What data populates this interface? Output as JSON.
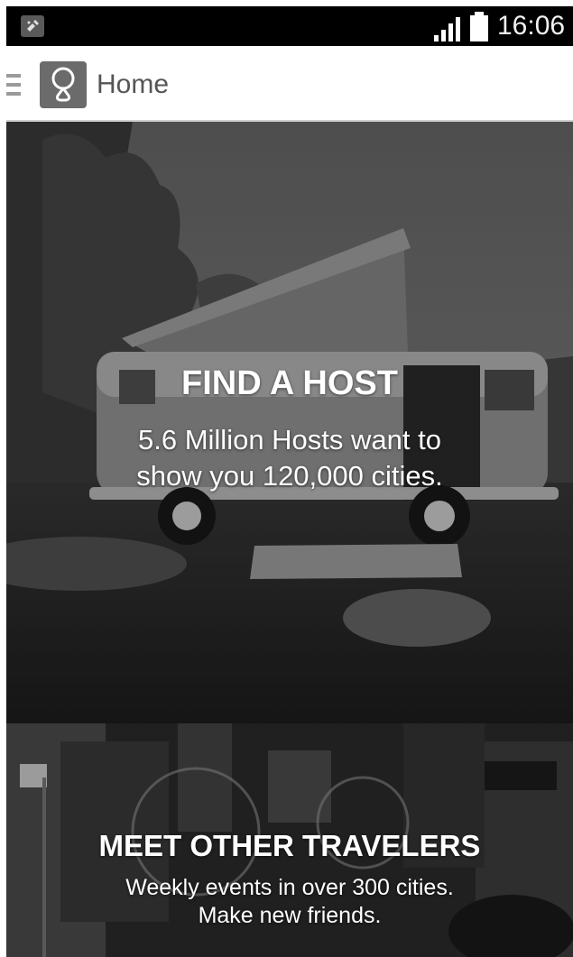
{
  "status_bar": {
    "time": "16:06",
    "notification_icon": "app-notification-icon",
    "signal_icon": "signal-strength-icon",
    "battery_icon": "battery-icon"
  },
  "action_bar": {
    "menu_icon": "hamburger-menu-icon",
    "logo_icon": "couchsurfing-logo-icon",
    "title": "Home"
  },
  "cards": {
    "host": {
      "title": "FIND A HOST",
      "line1": "5.6 Million Hosts want to",
      "line2": "show you 120,000 cities."
    },
    "meet": {
      "title": "MEET OTHER TRAVELERS",
      "line1": "Weekly events in over 300 cities.",
      "line2": "Make new friends."
    }
  },
  "colors": {
    "status_bar_bg": "#000000",
    "action_bar_bg": "#ffffff",
    "title_text": "#555555",
    "overlay_text": "#ffffff"
  }
}
